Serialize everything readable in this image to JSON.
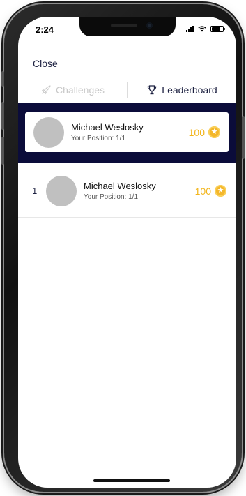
{
  "status_bar": {
    "time": "2:24"
  },
  "header": {
    "close_label": "Close"
  },
  "tabs": [
    {
      "label": "Challenges",
      "icon": "rocket-icon",
      "active": false
    },
    {
      "label": "Leaderboard",
      "icon": "trophy-icon",
      "active": true
    }
  ],
  "current_user": {
    "name": "Michael Weslosky",
    "position": "Your Position: 1/1",
    "score": "100"
  },
  "leaderboard": [
    {
      "rank": "1",
      "name": "Michael Weslosky",
      "position": "Your Position: 1/1",
      "score": "100"
    }
  ],
  "colors": {
    "brand_dark": "#0b0c3a",
    "score_gold": "#f2b51b",
    "avatar_placeholder": "#c0c0c0"
  }
}
